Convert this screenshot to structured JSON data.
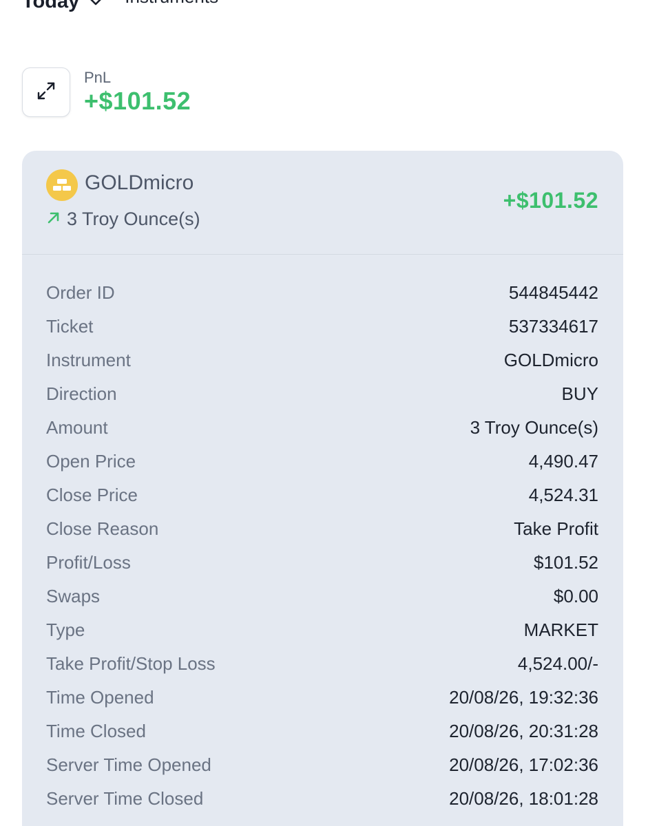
{
  "filters": {
    "period_label": "Today",
    "instruments_label": "Instruments"
  },
  "summary": {
    "pnl_label": "PnL",
    "pnl_value": "+$101.52"
  },
  "trade": {
    "instrument": "GOLDmicro",
    "amount": "3 Troy Ounce(s)",
    "pnl": "+$101.52",
    "details": [
      {
        "label": "Order ID",
        "value": "544845442"
      },
      {
        "label": "Ticket",
        "value": "537334617"
      },
      {
        "label": "Instrument",
        "value": "GOLDmicro"
      },
      {
        "label": "Direction",
        "value": "BUY"
      },
      {
        "label": "Amount",
        "value": "3 Troy Ounce(s)"
      },
      {
        "label": "Open Price",
        "value": "4,490.47"
      },
      {
        "label": "Close Price",
        "value": "4,524.31"
      },
      {
        "label": "Close Reason",
        "value": "Take Profit"
      },
      {
        "label": "Profit/Loss",
        "value": "$101.52"
      },
      {
        "label": "Swaps",
        "value": "$0.00"
      },
      {
        "label": "Type",
        "value": "MARKET"
      },
      {
        "label": "Take Profit/Stop Loss",
        "value": "4,524.00/-"
      },
      {
        "label": "Time Opened",
        "value": "20/08/26, 19:32:36"
      },
      {
        "label": "Time Closed",
        "value": "20/08/26, 20:31:28"
      },
      {
        "label": "Server Time Opened",
        "value": "20/08/26, 17:02:36"
      },
      {
        "label": "Server Time Closed",
        "value": "20/08/26, 18:01:28"
      }
    ]
  },
  "icons": {
    "swap": "swap-arrows-icon",
    "coin": "gold-bars-icon",
    "direction": "arrow-up-right-icon",
    "dropdown": "chevron-down-icon"
  },
  "colors": {
    "profit": "#3dbf6e",
    "card_bg": "#e4e9f1",
    "coin": "#f4c84a"
  }
}
